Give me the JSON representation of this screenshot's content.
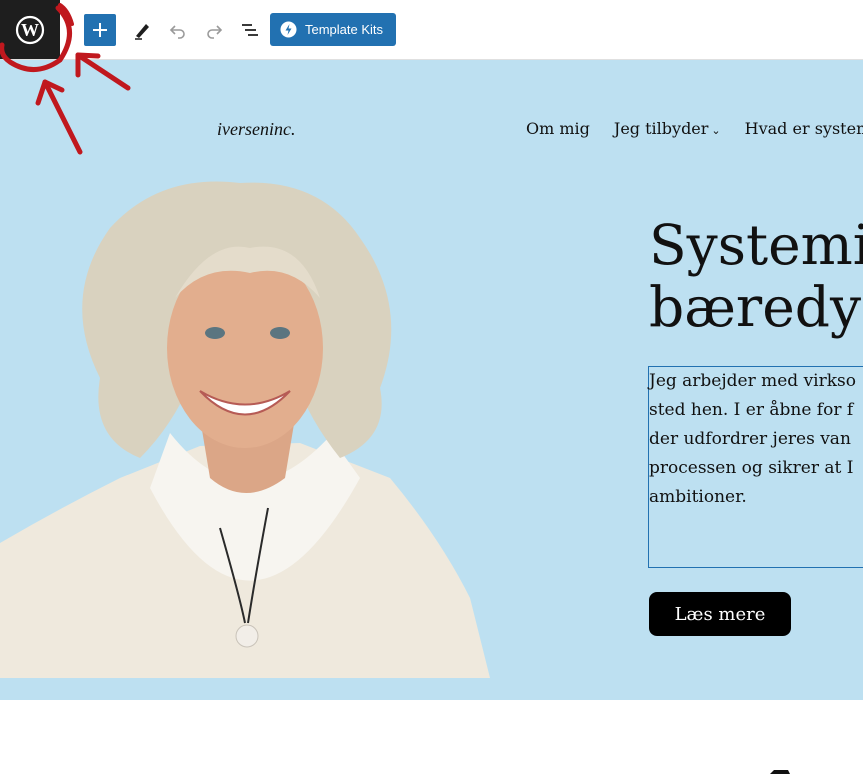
{
  "toolbar": {
    "add_block_icon": "plus-icon",
    "tools_icon": "pencil-icon",
    "undo_icon": "undo-icon",
    "redo_icon": "redo-icon",
    "list_view_icon": "list-view-icon",
    "template_kits_label": "Template Kits"
  },
  "site": {
    "title": "iverseninc.",
    "nav": [
      {
        "label": "Om mig"
      },
      {
        "label": "Jeg tilbyder",
        "chevron": "⌄"
      },
      {
        "label": "Hvad er system"
      }
    ]
  },
  "hero": {
    "heading_line1": "Systemi",
    "heading_line2": "bæredyg",
    "paragraph_lines": [
      "Jeg arbejder med virkso",
      "sted hen. I er åbne for f",
      "der udfordrer jeres van",
      "processen og sikrer at I",
      "ambitioner."
    ],
    "button_label": "Læs mere"
  },
  "colors": {
    "canvas_bg": "#bde0f1",
    "accent": "#2271b1",
    "annotation": "#c0181e"
  }
}
